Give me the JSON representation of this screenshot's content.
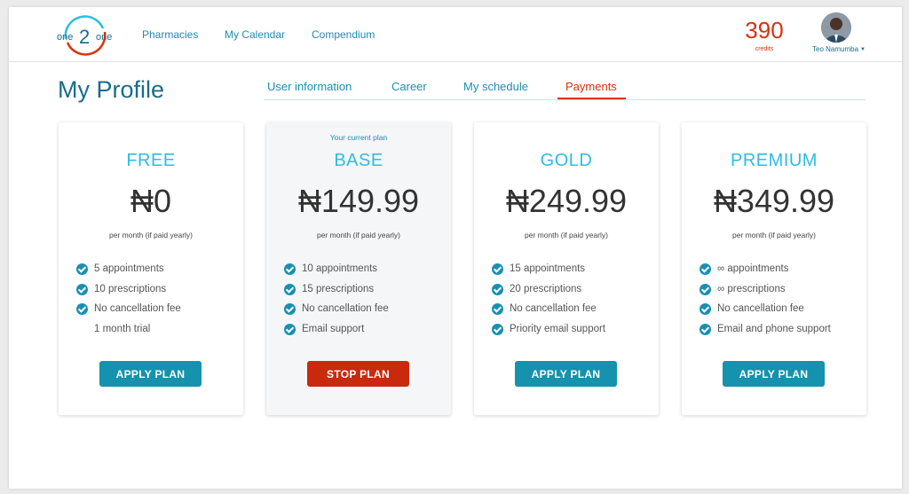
{
  "colors": {
    "brand_blue": "#1a8fb0",
    "accent_red": "#d9310f",
    "plan_name": "#2cbde4",
    "apply_button": "#1592ad",
    "stop_button": "#c92a0d"
  },
  "logo": {
    "left": "one",
    "center": "2",
    "right": "one"
  },
  "nav": {
    "items": [
      {
        "label": "Pharmacies"
      },
      {
        "label": "My Calendar"
      },
      {
        "label": "Compendium"
      }
    ]
  },
  "account": {
    "credits": "390",
    "credits_label": "credits",
    "user_name": "Teo Namumba",
    "avatar_icon": "user-avatar"
  },
  "page": {
    "title": "My Profile",
    "tabs": [
      {
        "label": "User information"
      },
      {
        "label": "Career"
      },
      {
        "label": "My schedule"
      },
      {
        "label": "Payments",
        "active": true
      }
    ]
  },
  "plans": [
    {
      "name": "FREE",
      "price": "₦0",
      "period": "per month (if paid yearly)",
      "features": [
        {
          "text": "5 appointments",
          "checked": true
        },
        {
          "text": "10 prescriptions",
          "checked": true
        },
        {
          "text": "No cancellation fee",
          "checked": true
        },
        {
          "text": "1 month trial",
          "checked": false
        }
      ],
      "button": "APPLY PLAN"
    },
    {
      "name": "BASE",
      "current_note": "Your current plan",
      "price": "₦149.99",
      "period": "per month (if paid yearly)",
      "features": [
        {
          "text": "10 appointments",
          "checked": true
        },
        {
          "text": "15 prescriptions",
          "checked": true
        },
        {
          "text": "No cancellation fee",
          "checked": true
        },
        {
          "text": "Email support",
          "checked": true
        }
      ],
      "button": "STOP PLAN"
    },
    {
      "name": "GOLD",
      "price": "₦249.99",
      "period": "per month (if paid yearly)",
      "features": [
        {
          "text": "15 appointments",
          "checked": true
        },
        {
          "text": "20 prescriptions",
          "checked": true
        },
        {
          "text": "No cancellation fee",
          "checked": true
        },
        {
          "text": "Priority email support",
          "checked": true
        }
      ],
      "button": "APPLY PLAN"
    },
    {
      "name": "PREMIUM",
      "price": "₦349.99",
      "period": "per month (if paid yearly)",
      "features": [
        {
          "text": "∞ appointments",
          "checked": true
        },
        {
          "text": "∞ prescriptions",
          "checked": true
        },
        {
          "text": "No cancellation fee",
          "checked": true
        },
        {
          "text": "Email and phone support",
          "checked": true
        }
      ],
      "button": "APPLY PLAN"
    }
  ]
}
